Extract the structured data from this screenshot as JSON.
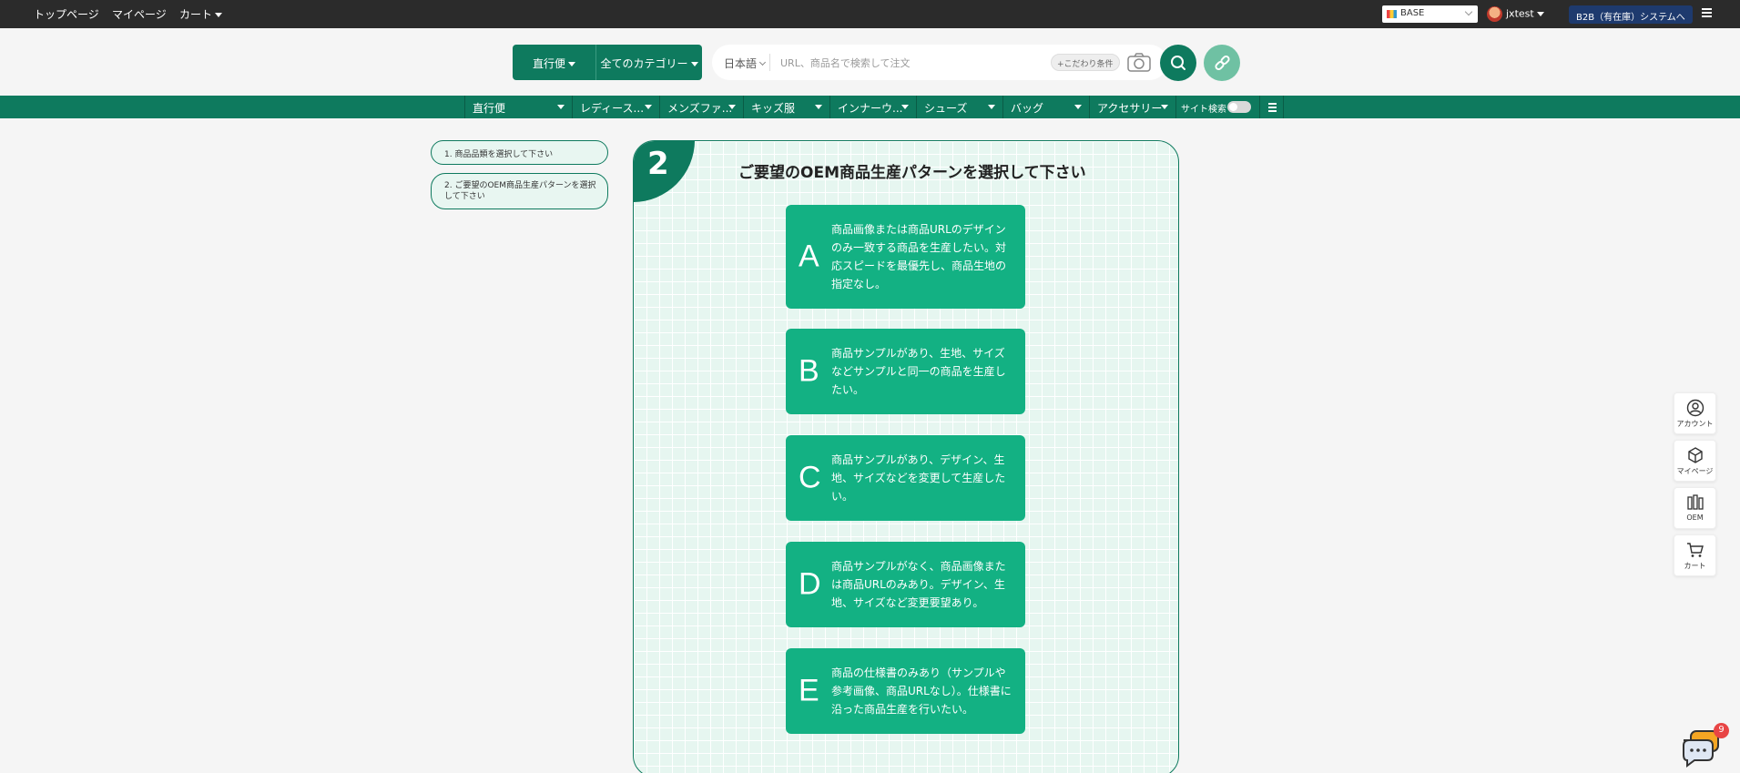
{
  "topbar": {
    "nav": [
      "トップページ",
      "マイページ",
      "カート"
    ],
    "shop_select": "BASE",
    "username": "jxtest",
    "b2b_button": "B2B（有在庫）システムへ"
  },
  "search": {
    "shipping_label": "直行便",
    "category_label": "全てのカテゴリー",
    "language": "日本語",
    "placeholder": "URL、商品名で検索して注文",
    "condition_chip": "+こだわり条件"
  },
  "categories": [
    {
      "label": "直行便"
    },
    {
      "label": "レディース..."
    },
    {
      "label": "メンズファ..."
    },
    {
      "label": "キッズ服"
    },
    {
      "label": "インナーウ..."
    },
    {
      "label": "シューズ"
    },
    {
      "label": "バッグ"
    },
    {
      "label": "アクセサリー"
    }
  ],
  "site_search_label": "サイト検索",
  "steps": [
    "1. 商品品類を選択して下さい",
    "2. ご要望のOEM商品生産パターンを選択して下さい"
  ],
  "panel": {
    "step_number": "2",
    "title": "ご要望のOEM商品生産パターンを選択して下さい",
    "options": [
      {
        "letter": "A",
        "text": "商品画像または商品URLのデザインのみ一致する商品を生産したい。対応スピードを最優先し、商品生地の指定なし。"
      },
      {
        "letter": "B",
        "text": "商品サンプルがあり、生地、サイズなどサンプルと同一の商品を生産したい。"
      },
      {
        "letter": "C",
        "text": "商品サンプルがあり、デザイン、生地、サイズなどを変更して生産したい。"
      },
      {
        "letter": "D",
        "text": "商品サンプルがなく、商品画像または商品URLのみあり。デザイン、生地、サイズなど変更要望あり。"
      },
      {
        "letter": "E",
        "text": "商品の仕様書のみあり（サンプルや参考画像、商品URLなし）。仕様書に沿った商品生産を行いたい。"
      }
    ]
  },
  "float_menu": [
    {
      "label": "アカウント",
      "icon": "account-icon"
    },
    {
      "label": "マイページ",
      "icon": "box-icon"
    },
    {
      "label": "OEM",
      "icon": "oem-icon"
    },
    {
      "label": "カート",
      "icon": "cart-icon"
    }
  ],
  "chat_badge": "9",
  "colors": {
    "brand_green": "#0e7a5e",
    "option_green": "#13b183",
    "topbar": "#2b2b2b",
    "b2b_blue": "#1e3a6e"
  }
}
